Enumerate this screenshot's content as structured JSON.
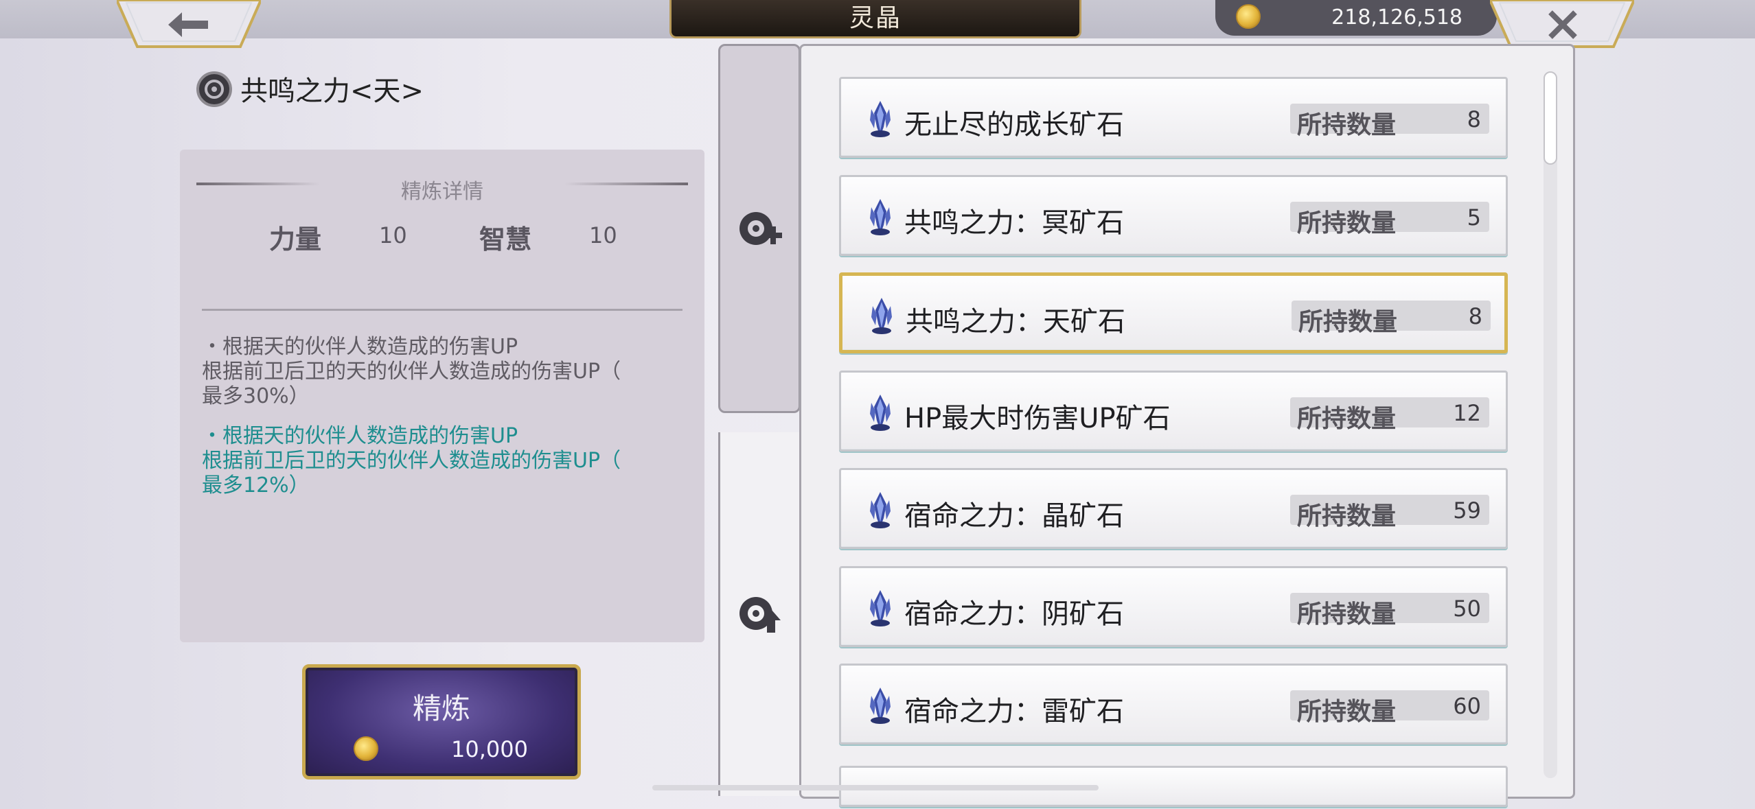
{
  "header": {
    "title": "灵晶",
    "currency_amount": "218,126,518"
  },
  "item": {
    "title": "共鸣之力<天>"
  },
  "details": {
    "heading": "精炼详情",
    "stats": [
      {
        "label": "力量",
        "value": "10"
      },
      {
        "label": "智慧",
        "value": "10"
      }
    ],
    "current_effect": {
      "line1": "・根据天的伙伴人数造成的伤害UP",
      "line2": "根据前卫后卫的天的伙伴人数造成的伤害UP（",
      "line3": "最多30%）"
    },
    "next_effect": {
      "line1": "・根据天的伙伴人数造成的伤害UP",
      "line2": "根据前卫后卫的天的伙伴人数造成的伤害UP（",
      "line3": "最多12%）"
    }
  },
  "refine_button": {
    "label": "精炼",
    "cost": "10,000"
  },
  "ore_list": {
    "quantity_label": "所持数量",
    "selected_index": 2,
    "items": [
      {
        "name": "无止尽的成长矿石",
        "quantity": "8"
      },
      {
        "name": "共鸣之力：冥矿石",
        "quantity": "5"
      },
      {
        "name": "共鸣之力：天矿石",
        "quantity": "8"
      },
      {
        "name": "HP最大时伤害UP矿石",
        "quantity": "12"
      },
      {
        "name": "宿命之力：晶矿石",
        "quantity": "59"
      },
      {
        "name": "宿命之力：阴矿石",
        "quantity": "50"
      },
      {
        "name": "宿命之力：雷矿石",
        "quantity": "60"
      }
    ]
  },
  "colors": {
    "accent_gold": "#d6b653",
    "effect_teal": "#1e8e8f",
    "button_purple": "#3e2f72"
  },
  "icons": [
    "back-arrow-icon",
    "close-icon",
    "coin-icon",
    "gear-icon",
    "crystal-icon",
    "gear-plus-icon",
    "gear-up-icon"
  ]
}
